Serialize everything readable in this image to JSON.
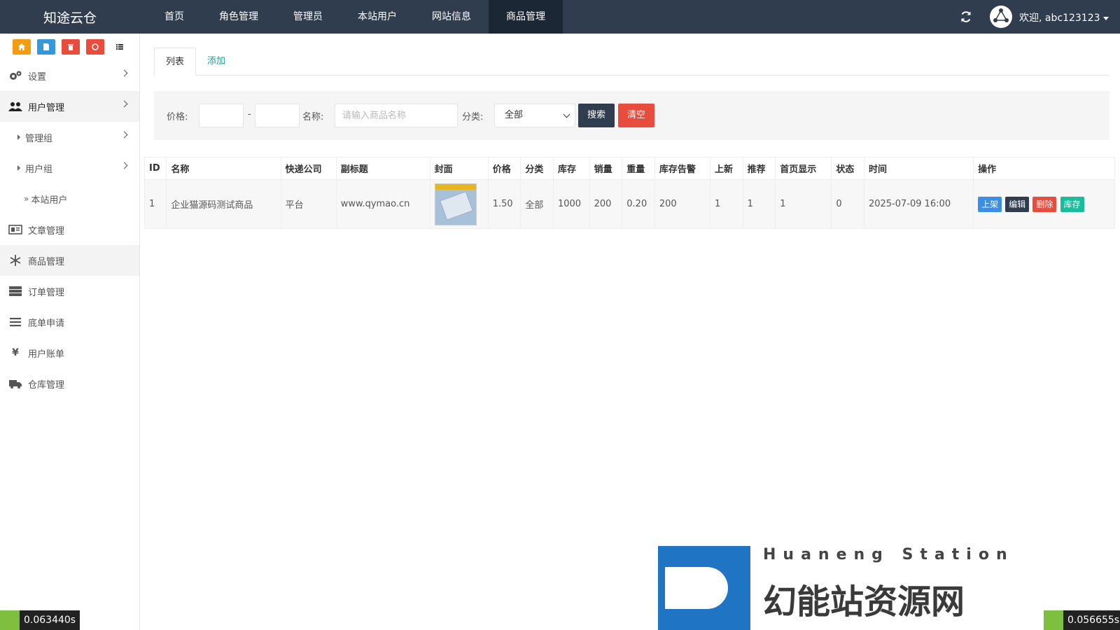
{
  "brand": "知途云仓",
  "topnav": [
    {
      "label": "首页"
    },
    {
      "label": "角色管理"
    },
    {
      "label": "管理员"
    },
    {
      "label": "本站用户"
    },
    {
      "label": "网站信息"
    },
    {
      "label": "商品管理",
      "active": true
    }
  ],
  "user": {
    "welcome": "欢迎, abc123123"
  },
  "quickbar": [
    {
      "icon": "home-icon",
      "color": "#f39c12"
    },
    {
      "icon": "file-icon",
      "color": "#3498db"
    },
    {
      "icon": "trash-icon",
      "color": "#e74c3c"
    },
    {
      "icon": "recycle-icon",
      "color": "#e74c3c"
    },
    {
      "icon": "list-icon",
      "color": "#ffffff"
    }
  ],
  "sidebar": {
    "items": [
      {
        "label": "设置",
        "icon": "gears-icon"
      },
      {
        "label": "用户管理",
        "icon": "users-icon"
      },
      {
        "label": "管理组"
      },
      {
        "label": "用户组"
      },
      {
        "label": "本站用户"
      },
      {
        "label": "文章管理",
        "icon": "newspaper-icon"
      },
      {
        "label": "商品管理",
        "icon": "snowflake-icon"
      },
      {
        "label": "订单管理",
        "icon": "server-icon"
      },
      {
        "label": "底单申请",
        "icon": "bars-icon"
      },
      {
        "label": "用户账单",
        "icon": "yen-icon"
      },
      {
        "label": "仓库管理",
        "icon": "truck-icon"
      }
    ]
  },
  "tabs": [
    {
      "label": "列表"
    },
    {
      "label": "添加"
    }
  ],
  "filter": {
    "price_label": "价格:",
    "dash": "-",
    "name_label": "名称:",
    "name_placeholder": "请输入商品名称",
    "category_label": "分类:",
    "category_value": "全部",
    "search_label": "搜索",
    "clear_label": "清空",
    "search_color": "#2f3d4f",
    "clear_color": "#e74c3c"
  },
  "table": {
    "headers": [
      "ID",
      "名称",
      "快递公司",
      "副标题",
      "封面",
      "价格",
      "分类",
      "库存",
      "销量",
      "重量",
      "库存告警",
      "上新",
      "推荐",
      "首页显示",
      "状态",
      "时间",
      "操作"
    ],
    "rows": [
      {
        "id": "1",
        "name": "企业猫源码测试商品",
        "courier": "平台",
        "subtitle": "www.qymao.cn",
        "price": "1.50",
        "category": "全部",
        "stock": "1000",
        "sales": "200",
        "weight": "0.20",
        "stock_alert": "200",
        "new": "1",
        "recommend": "1",
        "home_show": "1",
        "status": "0",
        "time": "2025-07-09 16:00",
        "actions": [
          {
            "label": "上架",
            "color": "#3a8ee6"
          },
          {
            "label": "编辑",
            "color": "#2f3d4f"
          },
          {
            "label": "删除",
            "color": "#e74c3c"
          },
          {
            "label": "库存",
            "color": "#1abc9c"
          }
        ]
      }
    ]
  },
  "timers": {
    "left": "0.063440s",
    "right": "0.056655s"
  },
  "watermark": {
    "sub": "Huaneng Station",
    "title": "幻能站资源网"
  }
}
